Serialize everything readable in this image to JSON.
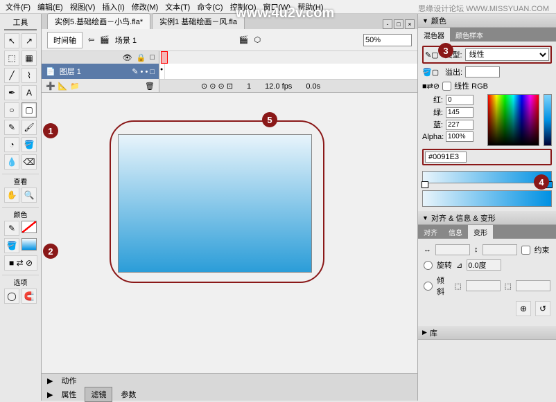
{
  "menu": {
    "file": "文件(F)",
    "edit": "编辑(E)",
    "view": "视图(V)",
    "insert": "插入(I)",
    "modify": "修改(M)",
    "text": "文本(T)",
    "commands": "命令(C)",
    "control": "控制(O)",
    "window": "窗口(W)",
    "help": "帮助(H)"
  },
  "watermark": "www.4u2v.com",
  "forum": "思缘设计论坛 WWW.MISSYUAN.COM",
  "toolbox": {
    "title": "工具",
    "view_label": "查看",
    "color_label": "颜色",
    "options_label": "选项"
  },
  "tabs": {
    "active": "实例5.基础绘画－小鸟.fla*",
    "inactive": "实例1 基础绘画－风.fla"
  },
  "scene": {
    "timeline_btn": "时间轴",
    "scene_label": "场景 1",
    "zoom": "50%"
  },
  "timeline": {
    "layer_name": "图层 1",
    "frame": "1",
    "fps": "12.0 fps",
    "time": "0.0s"
  },
  "markers": {
    "m1": "1",
    "m2": "2",
    "m3": "3",
    "m4": "4",
    "m5": "5"
  },
  "bottom_tabs": {
    "actions": "动作",
    "properties": "属性",
    "filters": "滤镜",
    "params": "参数"
  },
  "color_panel": {
    "title": "颜色",
    "mixer_tab": "混色器",
    "swatch_tab": "颜色样本",
    "type_label": "类型:",
    "type_value": "线性",
    "overflow_label": "溢出:",
    "linear_rgb": "线性 RGB",
    "r_label": "红:",
    "r_val": "0",
    "g_label": "绿:",
    "g_val": "145",
    "b_label": "蓝:",
    "b_val": "227",
    "alpha_label": "Alpha:",
    "alpha_val": "100%",
    "hex": "#0091E3"
  },
  "align_panel": {
    "title": "对齐 & 信息 & 变形",
    "align_tab": "对齐",
    "info_tab": "信息",
    "transform_tab": "变形",
    "constrain": "约束",
    "rotate": "旋转",
    "skew": "倾斜",
    "angle": "0.0度"
  },
  "library_panel": {
    "title": "库"
  }
}
